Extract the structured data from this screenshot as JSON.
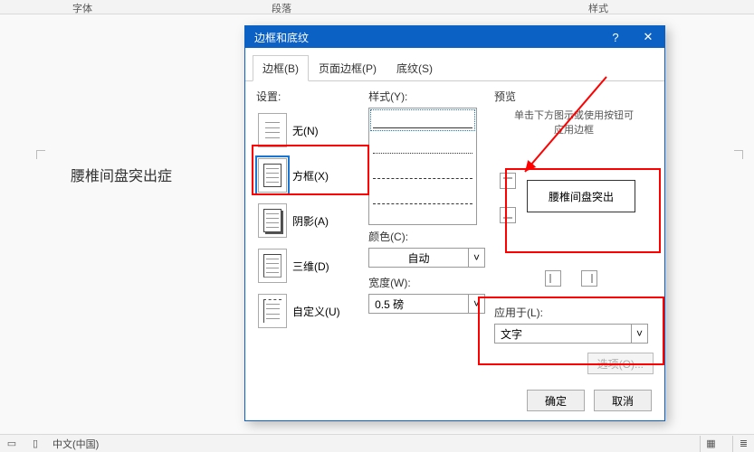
{
  "ribbon": {
    "font": "字体",
    "paragraph": "段落",
    "styles": "样式"
  },
  "doc": {
    "text": "腰椎间盘突出症"
  },
  "dialog": {
    "title": "边框和底纹",
    "help": "?",
    "close": "✕",
    "tabs": {
      "borders": "边框(B)",
      "page_border": "页面边框(P)",
      "shading": "底纹(S)"
    },
    "settings": {
      "label": "设置:",
      "none": "无(N)",
      "box": "方框(X)",
      "shadow": "阴影(A)",
      "three_d": "三维(D)",
      "custom": "自定义(U)"
    },
    "style": {
      "label": "样式(Y):"
    },
    "color": {
      "label": "颜色(C):",
      "value": "自动"
    },
    "width": {
      "label": "宽度(W):",
      "value": "0.5 磅"
    },
    "preview": {
      "label": "预览",
      "hint1": "单击下方图示或使用按钮可",
      "hint2": "应用边框",
      "sample": "腰椎间盘突出"
    },
    "apply": {
      "label": "应用于(L):",
      "value": "文字"
    },
    "options": "选项(O)...",
    "ok": "确定",
    "cancel": "取消"
  },
  "status": {
    "lang": "中文(中国)"
  }
}
